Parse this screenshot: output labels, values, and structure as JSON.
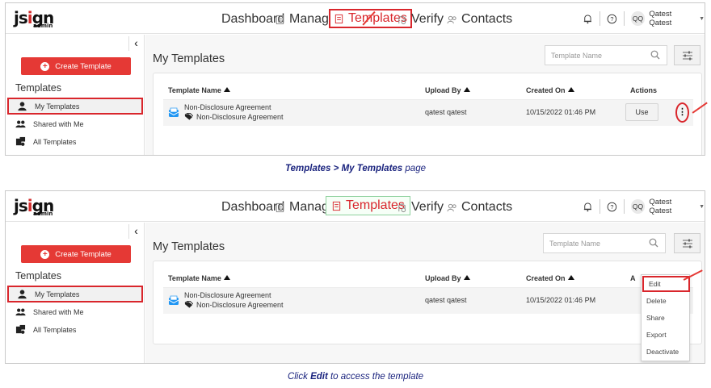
{
  "app": {
    "logo_text": "jsign",
    "logo_sub": "admin",
    "nav": [
      "Dashboard",
      "Manage",
      "Templates",
      "Verify",
      "Contacts"
    ],
    "user_initials": "QQ",
    "user_name": "Qatest Qatest"
  },
  "sidebar": {
    "create_label": "Create Template",
    "section_title": "Templates",
    "items": [
      "My Templates",
      "Shared with Me",
      "All Templates"
    ]
  },
  "main": {
    "title": "My Templates",
    "search_placeholder": "Template Name",
    "columns": [
      "Template Name",
      "Upload By",
      "Created On",
      "Actions"
    ],
    "columns_bottom_actions": "A",
    "rows": [
      {
        "name": "Non-Disclosure Agreement",
        "tag": "Non-Disclosure Agreement",
        "upload_by": "qatest qatest",
        "created_on": "10/15/2022 01:46 PM",
        "action": "Use"
      }
    ],
    "menu": [
      "Edit",
      "Delete",
      "Share",
      "Export",
      "Deactivate"
    ]
  },
  "captions": {
    "top": {
      "a": "Templates",
      "sep": " > ",
      "b": "My Templates",
      "c": " page"
    },
    "bottom": {
      "a": "Click ",
      "b": "Edit",
      "c": " to access the template"
    }
  },
  "colors": {
    "accent_red": "#e53935",
    "highlight_red": "#d9262c",
    "caption_blue": "#1a237e"
  }
}
